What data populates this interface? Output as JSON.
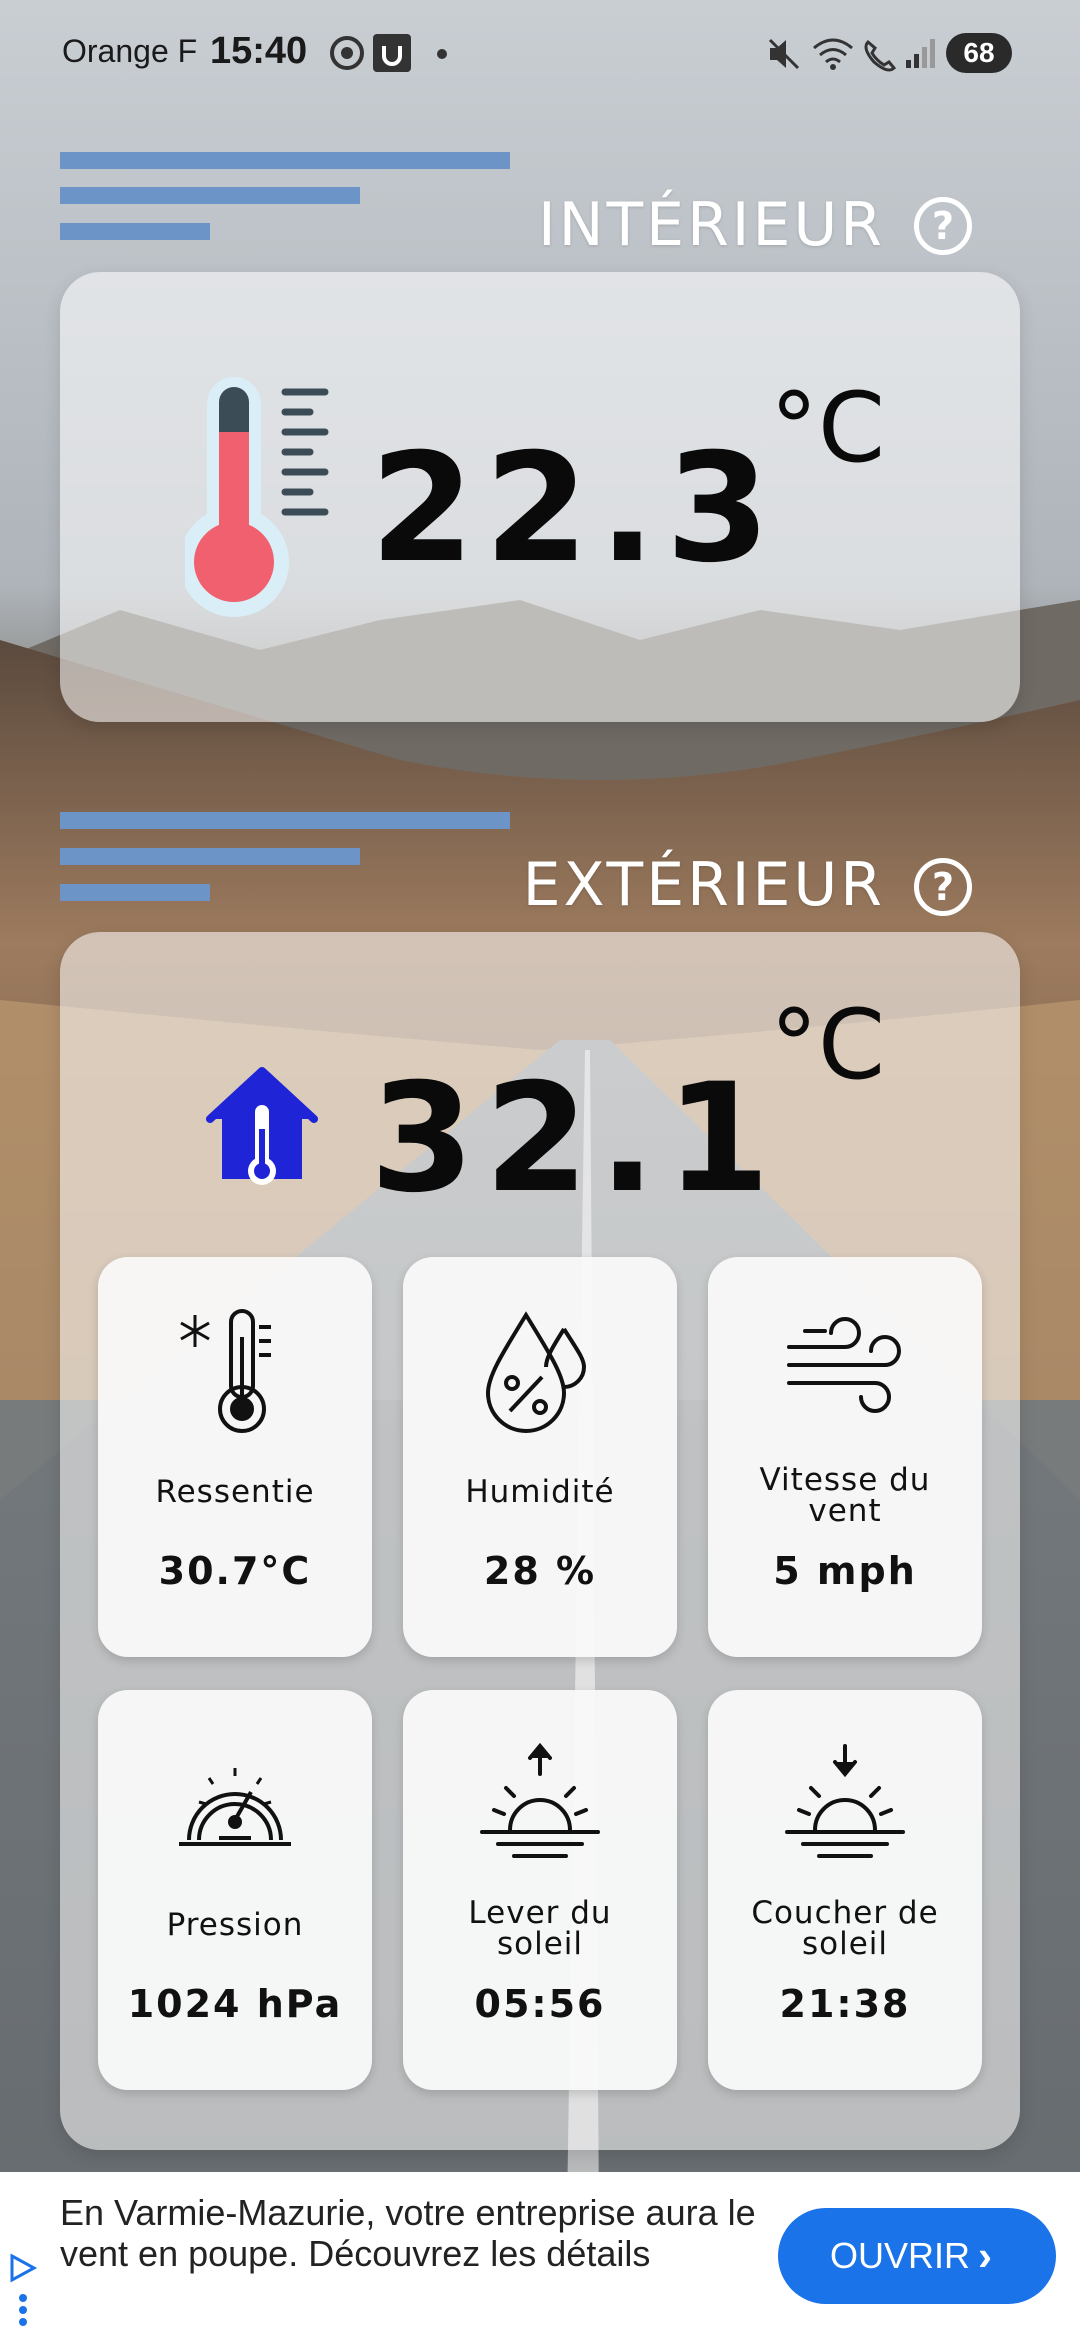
{
  "status_bar": {
    "carrier": "Orange F",
    "time": "15:40",
    "battery": "68"
  },
  "colors": {
    "accent_blue": "#6c94c7",
    "thermometer_red": "#f0606e",
    "house_blue": "#1f24d6",
    "ad_button": "#1a73e8"
  },
  "interior": {
    "title": "INTÉRIEUR",
    "help": "?",
    "temperature": "22.3",
    "unit": "°C",
    "icon": "thermometer-icon"
  },
  "exterior": {
    "title": "EXTÉRIEUR",
    "help": "?",
    "temperature": "32.1",
    "unit": "°C",
    "icon": "house-thermometer-icon",
    "cards": [
      {
        "label": "Ressentie",
        "value": "30.7°C",
        "icon": "feels-like-icon"
      },
      {
        "label": "Humidité",
        "value": "28 %",
        "icon": "humidity-icon"
      },
      {
        "label": "Vitesse du vent",
        "value": "5 mph",
        "icon": "wind-icon"
      },
      {
        "label": "Pression",
        "value": "1024 hPa",
        "icon": "gauge-icon"
      },
      {
        "label": "Lever du soleil",
        "value": "05:56",
        "icon": "sunrise-icon"
      },
      {
        "label": "Coucher de soleil",
        "value": "21:38",
        "icon": "sunset-icon"
      }
    ]
  },
  "ad": {
    "text": "En Varmie-Mazurie, votre entreprise aura le vent en poupe. Découvrez les détails",
    "button": "OUVRIR",
    "chevron": "›"
  }
}
